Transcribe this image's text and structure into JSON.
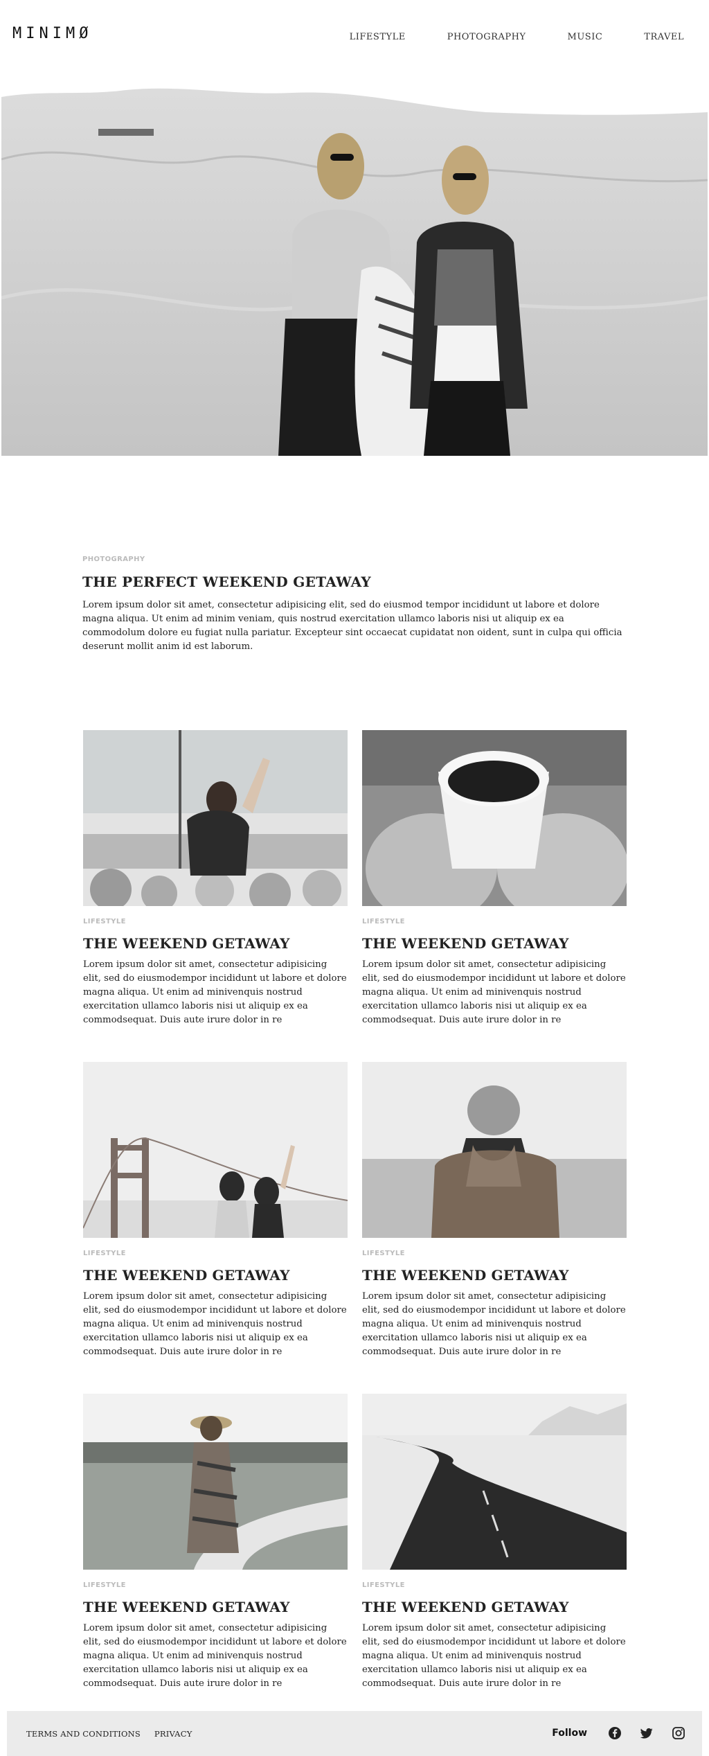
{
  "site": {
    "logo": "MINIMØ"
  },
  "nav": [
    {
      "label": "LIFESTYLE"
    },
    {
      "label": "PHOTOGRAPHY"
    },
    {
      "label": "MUSIC"
    },
    {
      "label": "TRAVEL"
    }
  ],
  "featured": {
    "category": "PHOTOGRAPHY",
    "title": "THE PERFECT WEEKEND GETAWAY",
    "body": "Lorem ipsum dolor sit amet, consectetur adipisicing elit, sed do eiusmod tempor incididunt ut labore et dolore magna aliqua. Ut enim ad minim veniam, quis nostrud exercitation ullamco laboris nisi ut aliquip ex ea commodolum dolore eu fugiat nulla pariatur. Excepteur sint occaecat cupidatat non oident, sunt in culpa qui officia deserunt mollit anim id est laborum."
  },
  "posts": [
    {
      "category": "LIFESTYLE",
      "title": "THE WEEKEND GETAWAY",
      "excerpt": "Lorem ipsum dolor sit amet, consectetur adipisicing elit, sed do eiusmodempor incididunt ut labore et dolore magna aliqua. Ut enim ad minivenquis nostrud exercitation ullamco laboris nisi ut aliquip ex ea commodsequat. Duis aute irure dolor in re"
    },
    {
      "category": "LIFESTYLE",
      "title": "THE WEEKEND GETAWAY",
      "excerpt": "Lorem ipsum dolor sit amet, consectetur adipisicing elit, sed do eiusmodempor incididunt ut labore et dolore magna aliqua. Ut enim ad minivenquis nostrud exercitation ullamco laboris nisi ut aliquip ex ea commodsequat. Duis aute irure dolor in re"
    },
    {
      "category": "LIFESTYLE",
      "title": "THE WEEKEND GETAWAY",
      "excerpt": "Lorem ipsum dolor sit amet, consectetur adipisicing elit, sed do eiusmodempor incididunt ut labore et dolore magna aliqua. Ut enim ad minivenquis nostrud exercitation ullamco laboris nisi ut aliquip ex ea commodsequat. Duis aute irure dolor in re"
    },
    {
      "category": "LIFESTYLE",
      "title": "THE WEEKEND GETAWAY",
      "excerpt": "Lorem ipsum dolor sit amet, consectetur adipisicing elit, sed do eiusmodempor incididunt ut labore et dolore magna aliqua. Ut enim ad minivenquis nostrud exercitation ullamco laboris nisi ut aliquip ex ea commodsequat. Duis aute irure dolor in re"
    },
    {
      "category": "LIFESTYLE",
      "title": "THE WEEKEND GETAWAY",
      "excerpt": "Lorem ipsum dolor sit amet, consectetur adipisicing elit, sed do eiusmodempor incididunt ut labore et dolore magna aliqua. Ut enim ad minivenquis nostrud exercitation ullamco laboris nisi ut aliquip ex ea commodsequat. Duis aute irure dolor in re"
    },
    {
      "category": "LIFESTYLE",
      "title": "THE WEEKEND GETAWAY",
      "excerpt": "Lorem ipsum dolor sit amet, consectetur adipisicing elit, sed do eiusmodempor incididunt ut labore et dolore magna aliqua. Ut enim ad minivenquis nostrud exercitation ullamco laboris nisi ut aliquip ex ea commodsequat. Duis aute irure dolor in re"
    }
  ],
  "footer": {
    "links": [
      {
        "label": "TERMS AND CONDITIONS"
      },
      {
        "label": "PRIVACY"
      }
    ],
    "follow_label": "Follow",
    "social_icons": [
      "facebook-icon",
      "twitter-icon",
      "instagram-icon"
    ]
  },
  "colors": {
    "text": "#222222",
    "category": "#bbbbbb",
    "footer_bg": "#ebebeb"
  }
}
